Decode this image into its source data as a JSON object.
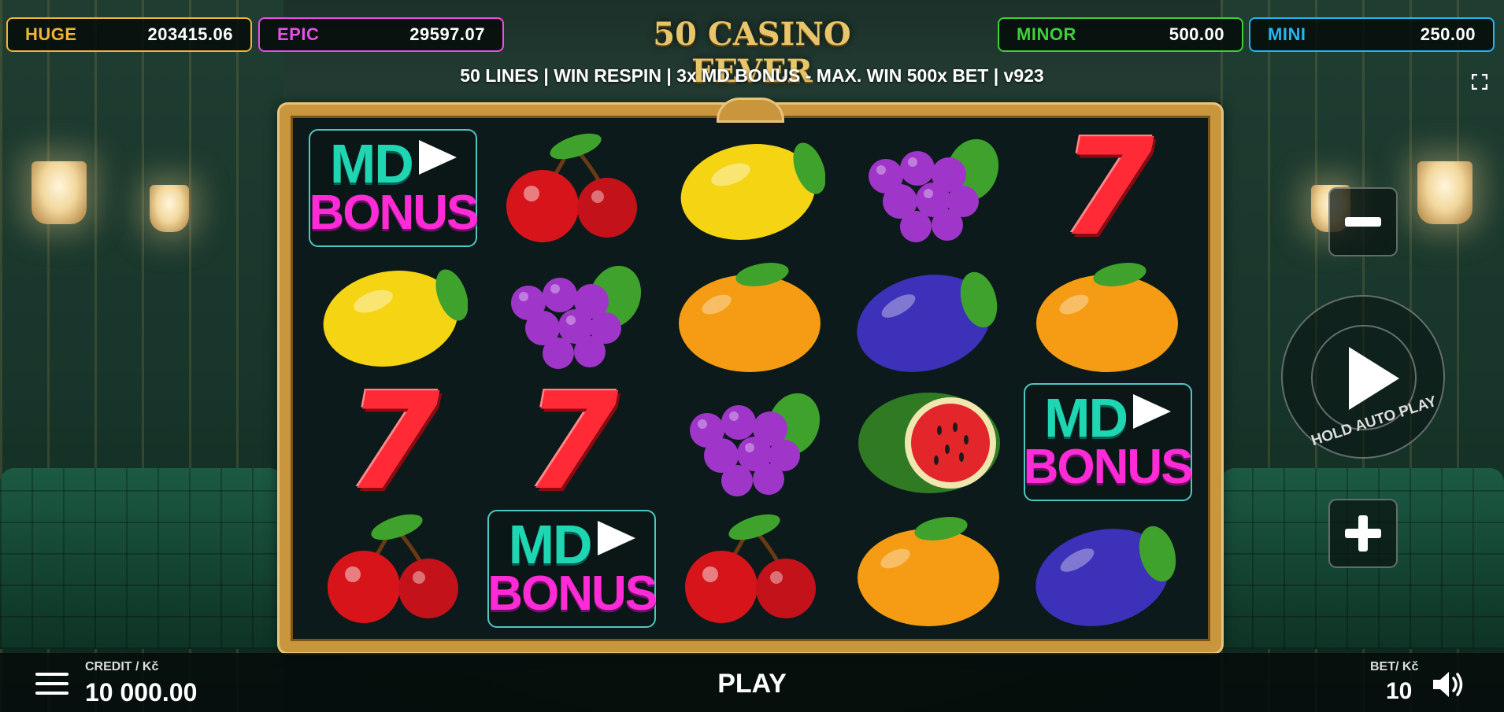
{
  "jackpots": [
    {
      "label": "HUGE",
      "value": "203415.06",
      "color": "#f0b534"
    },
    {
      "label": "EPIC",
      "value": "29597.07",
      "color": "#e94ee6"
    },
    {
      "label": "MINOR",
      "value": "500.00",
      "color": "#3fcf3a"
    },
    {
      "label": "MINI",
      "value": "250.00",
      "color": "#23b6f0"
    }
  ],
  "logo": "50 CASINO FEVER",
  "info_line": "50 LINES | WIN RESPIN | 3x MD BONUS - MAX. WIN 500x BET | v923",
  "reels": [
    [
      "md-bonus",
      "cherry",
      "lemon",
      "grapes",
      "seven"
    ],
    [
      "lemon",
      "grapes",
      "orange",
      "plum",
      "orange"
    ],
    [
      "seven",
      "seven",
      "grapes",
      "watermelon",
      "md-bonus"
    ],
    [
      "cherry",
      "md-bonus",
      "cherry",
      "orange",
      "plum"
    ]
  ],
  "bonus_symbol": {
    "top": "MD",
    "bottom": "BONUS"
  },
  "seven_glyph": "7",
  "controls": {
    "minus_icon": "minus-icon",
    "plus_icon": "plus-icon",
    "spin_label": "HOLD AUTO PLAY"
  },
  "bottom_bar": {
    "credit_label": "CREDIT / Kč",
    "credit_value": "10 000.00",
    "play_label": "PLAY",
    "bet_label": "BET/ Kč",
    "bet_value": "10"
  },
  "colors": {
    "frame_gold": "#c9963e",
    "reel_background": "#0c1a1b",
    "bonus_teal": "#1fd6b2",
    "bonus_pink": "#ff2bd6"
  }
}
